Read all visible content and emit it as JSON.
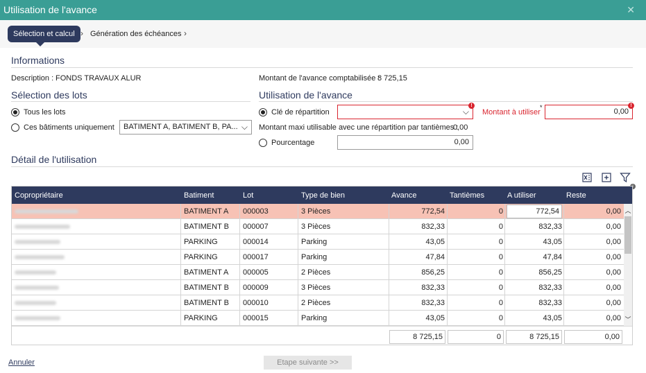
{
  "window": {
    "title": "Utilisation de l'avance",
    "close_glyph": "✕"
  },
  "steps": {
    "active": "Sélection et calcul",
    "next": "Génération des échéances"
  },
  "informations": {
    "title": "Informations",
    "description_label": "Description :",
    "description_value": "FONDS TRAVAUX ALUR",
    "montant_label": "Montant de l'avance comptabilisée :",
    "montant_value": "8 725,15"
  },
  "selection_lots": {
    "title": "Sélection des lots",
    "option_all": "Tous les lots",
    "option_some": "Ces bâtiments uniquement",
    "batiments_value": "BATIMENT A, BATIMENT B, PA...",
    "selected": "all"
  },
  "utilisation": {
    "title": "Utilisation de l'avance",
    "cle_label": "Clé de répartition",
    "cle_value": "",
    "montant_utiliser_label": "Montant à utiliser",
    "required_mark": "*",
    "montant_utiliser_value": "0,00",
    "maxi_label": "Montant maxi utilisable avec une répartition par tantièmes :",
    "maxi_value": "0,00",
    "pourcentage_label": "Pourcentage",
    "pourcentage_value": "0,00",
    "selected": "cle"
  },
  "detail": {
    "title": "Détail de l'utilisation",
    "columns": [
      "Copropriétaire",
      "Batiment",
      "Lot",
      "Type de bien",
      "Avance",
      "Tantièmes",
      "A utiliser",
      "Reste"
    ],
    "rows": [
      {
        "owner": "",
        "batiment": "BATIMENT A",
        "lot": "000003",
        "type": "3 Pièces",
        "avance": "772,54",
        "tantiemes": "0",
        "utiliser": "772,54",
        "reste": "0,00"
      },
      {
        "owner": "",
        "batiment": "BATIMENT B",
        "lot": "000007",
        "type": "3 Pièces",
        "avance": "832,33",
        "tantiemes": "0",
        "utiliser": "832,33",
        "reste": "0,00"
      },
      {
        "owner": "",
        "batiment": "PARKING",
        "lot": "000014",
        "type": "Parking",
        "avance": "43,05",
        "tantiemes": "0",
        "utiliser": "43,05",
        "reste": "0,00"
      },
      {
        "owner": "",
        "batiment": "PARKING",
        "lot": "000017",
        "type": "Parking",
        "avance": "47,84",
        "tantiemes": "0",
        "utiliser": "47,84",
        "reste": "0,00"
      },
      {
        "owner": "",
        "batiment": "BATIMENT A",
        "lot": "000005",
        "type": "2 Pièces",
        "avance": "856,25",
        "tantiemes": "0",
        "utiliser": "856,25",
        "reste": "0,00"
      },
      {
        "owner": "",
        "batiment": "BATIMENT B",
        "lot": "000009",
        "type": "3 Pièces",
        "avance": "832,33",
        "tantiemes": "0",
        "utiliser": "832,33",
        "reste": "0,00"
      },
      {
        "owner": "",
        "batiment": "BATIMENT B",
        "lot": "000010",
        "type": "2 Pièces",
        "avance": "832,33",
        "tantiemes": "0",
        "utiliser": "832,33",
        "reste": "0,00"
      },
      {
        "owner": "",
        "batiment": "PARKING",
        "lot": "000015",
        "type": "Parking",
        "avance": "43,05",
        "tantiemes": "0",
        "utiliser": "43,05",
        "reste": "0,00"
      }
    ],
    "totals": {
      "avance": "8 725,15",
      "tantiemes": "0",
      "utiliser": "8 725,15",
      "reste": "0,00"
    },
    "toolbar_icons": [
      "excel-export-icon",
      "add-icon",
      "filter-icon"
    ]
  },
  "footer": {
    "cancel_label": "Annuler",
    "next_label": "Etape suivante >>"
  },
  "colors": {
    "titlebar": "#3a9e95",
    "navy": "#2e3a5e",
    "error": "#d9252f",
    "selected_row": "#f7c2b5"
  }
}
